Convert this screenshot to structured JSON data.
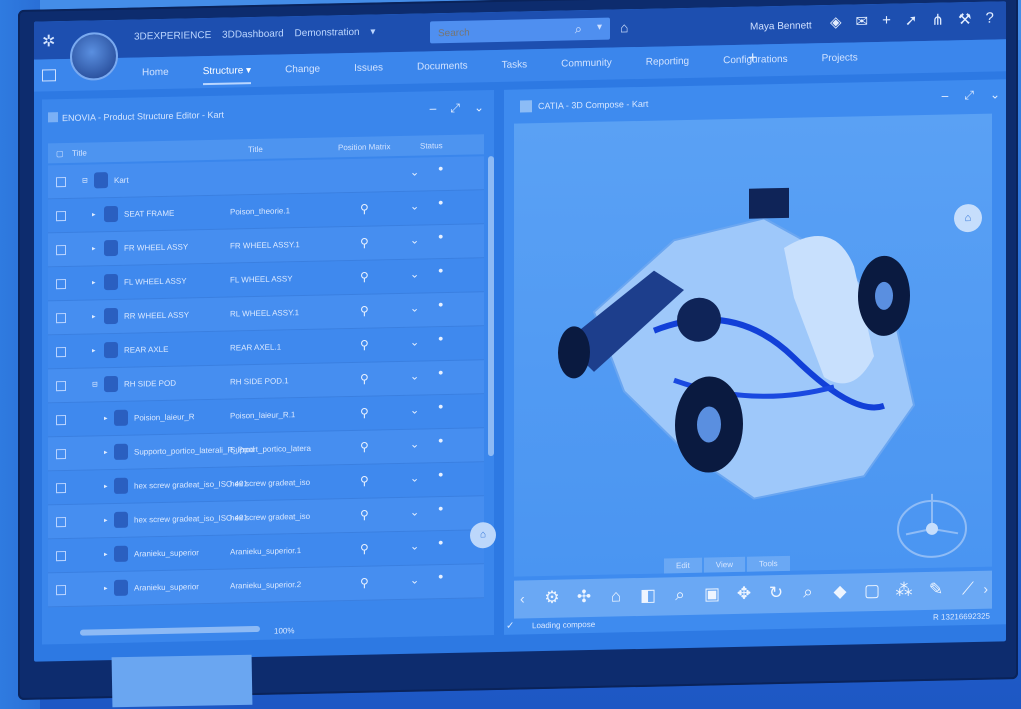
{
  "app": {
    "brand_parts": [
      "3DEXPERIENCE",
      "3DDashboard",
      "Demonstration"
    ],
    "search_placeholder": "Search",
    "user_name": "Maya Bennett"
  },
  "tabs": [
    {
      "label": "Home",
      "active": false
    },
    {
      "label": "Structure",
      "active": true
    },
    {
      "label": "Change",
      "active": false
    },
    {
      "label": "Issues",
      "active": false
    },
    {
      "label": "Documents",
      "active": false
    },
    {
      "label": "Tasks",
      "active": false
    },
    {
      "label": "Community",
      "active": false
    },
    {
      "label": "Reporting",
      "active": false
    },
    {
      "label": "Configurations",
      "active": false
    },
    {
      "label": "Projects",
      "active": false
    }
  ],
  "left_panel": {
    "title": "ENOVIA - Product Structure Editor - Kart",
    "columns": [
      "Title",
      "Title",
      "Position Matrix",
      "Status"
    ],
    "rows": [
      {
        "title": "Kart",
        "instance": "",
        "depth": 0
      },
      {
        "title": "SEAT FRAME",
        "instance": "Poison_theorie.1",
        "depth": 1
      },
      {
        "title": "FR WHEEL ASSY",
        "instance": "FR WHEEL ASSY.1",
        "depth": 1
      },
      {
        "title": "FL WHEEL ASSY",
        "instance": "FL WHEEL ASSY",
        "depth": 1
      },
      {
        "title": "RR WHEEL ASSY",
        "instance": "RL WHEEL ASSY.1",
        "depth": 1
      },
      {
        "title": "REAR AXLE",
        "instance": "REAR AXEL.1",
        "depth": 1
      },
      {
        "title": "RH SIDE POD",
        "instance": "RH SIDE POD.1",
        "depth": 1
      },
      {
        "title": "Poision_laieur_R",
        "instance": "Poison_laieur_R.1",
        "depth": 2
      },
      {
        "title": "Supporto_portico_laterali_R_Prod",
        "instance": "Support_portico_latera",
        "depth": 2
      },
      {
        "title": "hex screw gradeat_iso_ISO 401",
        "instance": "hex screw gradeat_iso",
        "depth": 2
      },
      {
        "title": "hex screw gradeat_iso_ISO 401",
        "instance": "hex screw gradeat_iso",
        "depth": 2
      },
      {
        "title": "Aranieku_superior",
        "instance": "Aranieku_superior.1",
        "depth": 2
      },
      {
        "title": "Aranieku_superior",
        "instance": "Aranieku_superior.2",
        "depth": 2
      }
    ],
    "zoom_label": "100%"
  },
  "right_panel": {
    "title": "CATIA - 3D Compose - Kart",
    "view_tabs": [
      "Edit",
      "View",
      "Tools"
    ],
    "status_text": "Loading compose",
    "coordinate_text": "R 13216692325"
  }
}
